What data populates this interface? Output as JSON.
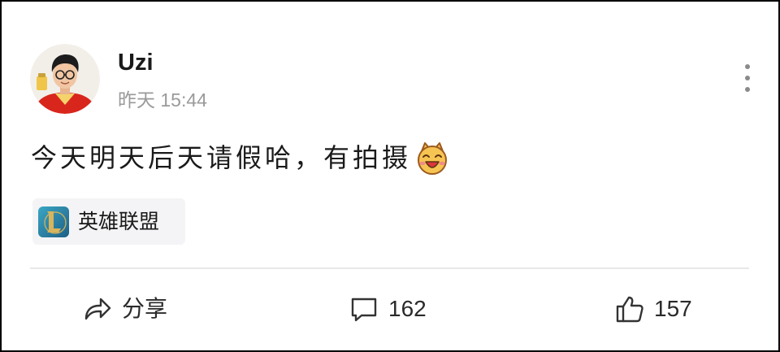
{
  "post": {
    "author": {
      "name": "Uzi"
    },
    "timestamp": "昨天 15:44",
    "text": "今天明天后天请假哈，有拍摄",
    "emoji_icon": "laughing-emoji-icon",
    "topic_tag": {
      "label": "英雄联盟",
      "icon": "league-of-legends-icon"
    }
  },
  "more_options": {
    "icon": "more-vertical-icon"
  },
  "actions": {
    "share": {
      "label": "分享",
      "icon": "share-icon"
    },
    "comment": {
      "count": "162",
      "icon": "comment-icon"
    },
    "like": {
      "count": "157",
      "icon": "thumbs-up-icon"
    }
  },
  "colors": {
    "text": "#1a1a1a",
    "secondary_text": "#9a9a9a",
    "chip_background": "#f4f4f6",
    "divider": "#e8e8e8",
    "border": "#000000"
  }
}
